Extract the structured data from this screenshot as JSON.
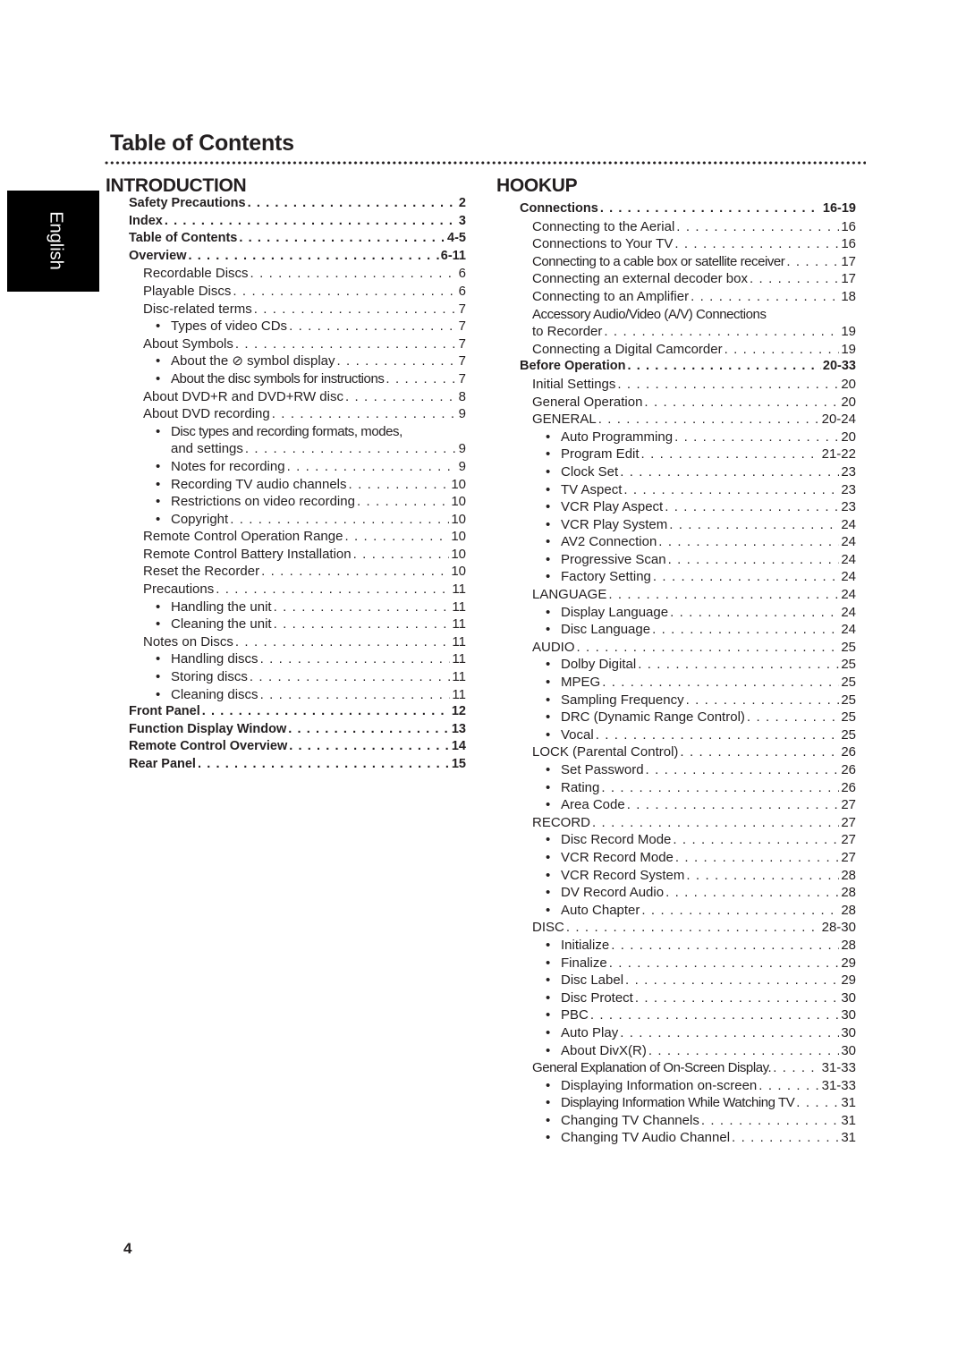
{
  "title": "Table of Contents",
  "language_tab": "English",
  "page_number": "4",
  "sections": {
    "introduction": {
      "heading": "INTRODUCTION",
      "entries": [
        {
          "level": 0,
          "label": "Safety Precautions",
          "page": "2"
        },
        {
          "level": 0,
          "label": "Index",
          "page": "3"
        },
        {
          "level": 0,
          "label": "Table of Contents",
          "page": "4-5"
        },
        {
          "level": 0,
          "label": "Overview",
          "page": "6-11"
        },
        {
          "level": 1,
          "label": "Recordable Discs",
          "page": "6"
        },
        {
          "level": 1,
          "label": "Playable Discs",
          "page": "6"
        },
        {
          "level": 1,
          "label": "Disc-related terms",
          "page": "7"
        },
        {
          "level": 2,
          "label": "Types of video CDs",
          "page": "7"
        },
        {
          "level": 1,
          "label": "About Symbols",
          "page": "7"
        },
        {
          "level": 2,
          "label": "About the ⊘ symbol display",
          "page": "7"
        },
        {
          "level": 2,
          "label": "About the disc symbols for instructions",
          "page": "7"
        },
        {
          "level": 1,
          "label": "About DVD+R and DVD+RW disc",
          "page": "8"
        },
        {
          "level": 1,
          "label": "About DVD recording",
          "page": "9"
        },
        {
          "level": 2,
          "label": "Disc types and recording formats, modes,",
          "page": ""
        },
        {
          "level": 3,
          "label": "and settings",
          "page": "9"
        },
        {
          "level": 2,
          "label": "Notes for recording",
          "page": "9"
        },
        {
          "level": 2,
          "label": "Recording TV audio channels",
          "page": "10"
        },
        {
          "level": 2,
          "label": "Restrictions on video recording",
          "page": "10"
        },
        {
          "level": 2,
          "label": "Copyright",
          "page": "10"
        },
        {
          "level": 1,
          "label": "Remote Control Operation Range",
          "page": "10"
        },
        {
          "level": 1,
          "label": "Remote Control Battery Installation",
          "page": "10"
        },
        {
          "level": 1,
          "label": "Reset the Recorder",
          "page": "10"
        },
        {
          "level": 1,
          "label": "Precautions",
          "page": "11"
        },
        {
          "level": 2,
          "label": "Handling the unit",
          "page": "11"
        },
        {
          "level": 2,
          "label": "Cleaning the unit",
          "page": "11"
        },
        {
          "level": 1,
          "label": "Notes on Discs",
          "page": "11"
        },
        {
          "level": 2,
          "label": "Handling discs",
          "page": "11"
        },
        {
          "level": 2,
          "label": "Storing discs",
          "page": "11"
        },
        {
          "level": 2,
          "label": "Cleaning discs",
          "page": "11"
        },
        {
          "level": 0,
          "label": "Front Panel",
          "page": "12"
        },
        {
          "level": 0,
          "label": "Function Display Window",
          "page": "13"
        },
        {
          "level": 0,
          "label": "Remote Control Overview",
          "page": "14"
        },
        {
          "level": 0,
          "label": "Rear Panel",
          "page": "15"
        }
      ]
    },
    "hookup": {
      "heading": "HOOKUP",
      "entries": [
        {
          "level": 0,
          "label": "Connections",
          "page": "16-19"
        },
        {
          "level": 1,
          "label": "Connecting to the Aerial",
          "page": "16"
        },
        {
          "level": 1,
          "label": "Connections to Your TV",
          "page": "16"
        },
        {
          "level": 1,
          "label": "Connecting to a cable box or satellite receiver",
          "page": "17"
        },
        {
          "level": 1,
          "label": "Connecting an external decoder box",
          "page": "17"
        },
        {
          "level": 1,
          "label": "Connecting to an Amplifier",
          "page": "18"
        },
        {
          "level": 1,
          "label": "Accessory Audio/Video (A/V) Connections",
          "page": ""
        },
        {
          "level": 1,
          "label": "to Recorder",
          "page": "19"
        },
        {
          "level": 1,
          "label": "Connecting a Digital Camcorder",
          "page": "19"
        },
        {
          "level": 0,
          "label": "Before Operation",
          "page": "20-33"
        },
        {
          "level": 1,
          "label": "Initial Settings",
          "page": "20"
        },
        {
          "level": 1,
          "label": "General Operation",
          "page": "20"
        },
        {
          "level": 1,
          "label": "GENERAL",
          "page": "20-24"
        },
        {
          "level": 2,
          "label": "Auto Programming",
          "page": "20"
        },
        {
          "level": 2,
          "label": "Program Edit",
          "page": "21-22"
        },
        {
          "level": 2,
          "label": "Clock Set",
          "page": "23"
        },
        {
          "level": 2,
          "label": "TV Aspect",
          "page": "23"
        },
        {
          "level": 2,
          "label": "VCR Play Aspect",
          "page": "23"
        },
        {
          "level": 2,
          "label": "VCR Play System",
          "page": "24"
        },
        {
          "level": 2,
          "label": "AV2 Connection",
          "page": "24"
        },
        {
          "level": 2,
          "label": "Progressive Scan",
          "page": "24"
        },
        {
          "level": 2,
          "label": "Factory Setting",
          "page": "24"
        },
        {
          "level": 1,
          "label": "LANGUAGE",
          "page": "24"
        },
        {
          "level": 2,
          "label": "Display Language",
          "page": "24"
        },
        {
          "level": 2,
          "label": "Disc Language",
          "page": "24"
        },
        {
          "level": 1,
          "label": "AUDIO",
          "page": "25"
        },
        {
          "level": 2,
          "label": "Dolby Digital",
          "page": "25"
        },
        {
          "level": 2,
          "label": "MPEG",
          "page": "25"
        },
        {
          "level": 2,
          "label": "Sampling Frequency",
          "page": "25"
        },
        {
          "level": 2,
          "label": "DRC (Dynamic Range Control)",
          "page": "25"
        },
        {
          "level": 2,
          "label": "Vocal",
          "page": "25"
        },
        {
          "level": 1,
          "label": "LOCK (Parental Control)",
          "page": "26"
        },
        {
          "level": 2,
          "label": "Set Password",
          "page": "26"
        },
        {
          "level": 2,
          "label": "Rating",
          "page": "26"
        },
        {
          "level": 2,
          "label": "Area Code",
          "page": "27"
        },
        {
          "level": 1,
          "label": "RECORD",
          "page": "27"
        },
        {
          "level": 2,
          "label": "Disc Record Mode",
          "page": "27"
        },
        {
          "level": 2,
          "label": "VCR Record Mode",
          "page": "27"
        },
        {
          "level": 2,
          "label": "VCR Record System",
          "page": "28"
        },
        {
          "level": 2,
          "label": "DV Record Audio",
          "page": "28"
        },
        {
          "level": 2,
          "label": "Auto Chapter",
          "page": "28"
        },
        {
          "level": 1,
          "label": "DISC",
          "page": "28-30"
        },
        {
          "level": 2,
          "label": "Initialize",
          "page": "28"
        },
        {
          "level": 2,
          "label": "Finalize",
          "page": "29"
        },
        {
          "level": 2,
          "label": "Disc Label",
          "page": "29"
        },
        {
          "level": 2,
          "label": "Disc Protect",
          "page": "30"
        },
        {
          "level": 2,
          "label": "PBC",
          "page": "30"
        },
        {
          "level": 2,
          "label": "Auto Play",
          "page": "30"
        },
        {
          "level": 2,
          "label": "About DivX(R)",
          "page": "30"
        },
        {
          "level": 1,
          "label": "General Explanation of On-Screen Display.",
          "page": "31-33"
        },
        {
          "level": 2,
          "label": "Displaying Information on-screen",
          "page": "31-33"
        },
        {
          "level": 2,
          "label": "Displaying Information While Watching TV",
          "page": "31"
        },
        {
          "level": 2,
          "label": "Changing TV Channels",
          "page": "31"
        },
        {
          "level": 2,
          "label": "Changing TV Audio Channel",
          "page": "31"
        }
      ]
    }
  }
}
